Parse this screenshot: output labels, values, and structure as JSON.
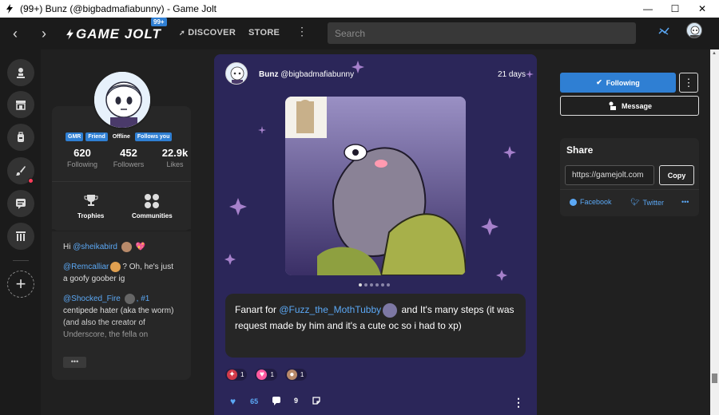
{
  "window": {
    "title": "(99+) Bunz (@bigbadmafiabunny) - Game Jolt",
    "minimize": "—",
    "maximize": "☐",
    "close": "✕"
  },
  "nav": {
    "logo": "GAME JOLT",
    "badge": "99+",
    "discover": "DISCOVER",
    "store": "STORE",
    "search_placeholder": "Search"
  },
  "profile": {
    "tags": [
      "GMR",
      "Friend",
      "Offline",
      "Follows you"
    ],
    "stats": [
      {
        "num": "620",
        "label": "Following"
      },
      {
        "num": "452",
        "label": "Followers"
      },
      {
        "num": "22.9k",
        "label": "Likes"
      }
    ],
    "trophies_label": "Trophies",
    "communities_label": "Communities",
    "bio": {
      "line1_prefix": "Hi ",
      "line1_link": "@sheikabird",
      "line2_link": "@Remcalliar",
      "line2_text": "? Oh, he's just a goofy goober ig",
      "line3_link": "@Shocked_Fire",
      "line3_link2": ", #1",
      "line3_text": "centipede hater (aka the worm) (and also the creator of Underscore, the fella on",
      "more": "•••"
    }
  },
  "post": {
    "author_name": "Bunz",
    "author_handle": "@bigbadmafiabunny",
    "time": "21 days",
    "caption_prefix": "Fanart for ",
    "caption_link": "@Fuzz_the_MothTubby",
    "caption_text": " and It's many steps (it was request made by him and it's a cute oc so i had to xp)",
    "reactions": [
      {
        "icon": "sticker-icon",
        "count": "1"
      },
      {
        "icon": "heart-sticker-icon",
        "count": "1"
      },
      {
        "icon": "character-sticker-icon",
        "count": "1"
      }
    ],
    "likes": "65",
    "comments": "9",
    "carousel_count": 6,
    "carousel_active": 1
  },
  "sidebar_right": {
    "following": "Following",
    "message": "Message",
    "share_title": "Share",
    "share_url": "https://gamejolt.com",
    "copy": "Copy",
    "facebook": "Facebook",
    "twitter": "Twitter",
    "more": "•••"
  },
  "colors": {
    "accent": "#2f7fd3",
    "link": "#5ba8f5",
    "notification": "#ff3d5a"
  }
}
